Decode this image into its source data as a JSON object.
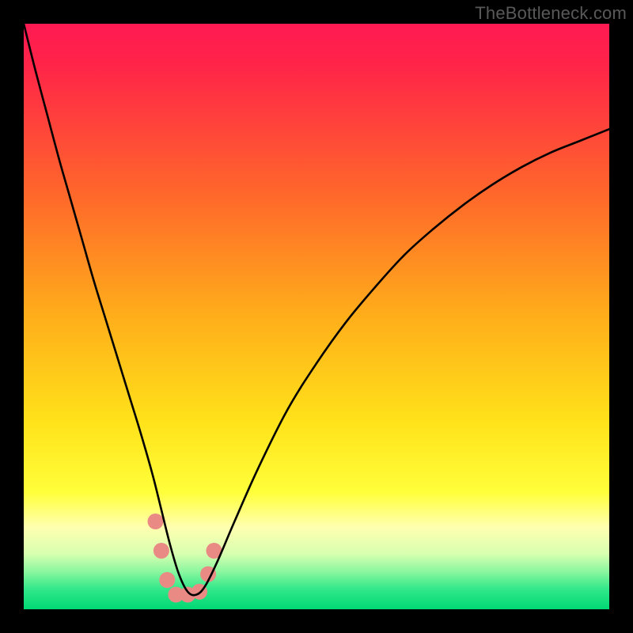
{
  "watermark": "TheBottleneck.com",
  "chart_data": {
    "type": "line",
    "title": "",
    "xlabel": "",
    "ylabel": "",
    "xlim": [
      0,
      100
    ],
    "ylim": [
      0,
      100
    ],
    "gradient_stops": [
      {
        "offset": 0.0,
        "color": "#ff1a52"
      },
      {
        "offset": 0.07,
        "color": "#ff2448"
      },
      {
        "offset": 0.3,
        "color": "#ff6a2a"
      },
      {
        "offset": 0.5,
        "color": "#ffae1a"
      },
      {
        "offset": 0.68,
        "color": "#ffe21a"
      },
      {
        "offset": 0.8,
        "color": "#ffff3a"
      },
      {
        "offset": 0.86,
        "color": "#ffffb0"
      },
      {
        "offset": 0.905,
        "color": "#d8ffb0"
      },
      {
        "offset": 0.935,
        "color": "#8cf7a0"
      },
      {
        "offset": 0.965,
        "color": "#33e88a"
      },
      {
        "offset": 1.0,
        "color": "#00d873"
      }
    ],
    "series": [
      {
        "name": "bottleneck-curve",
        "x": [
          0,
          2,
          4,
          6,
          8,
          10,
          12,
          14,
          16,
          18,
          20,
          22,
          23.5,
          25,
          26.5,
          28,
          29.5,
          31,
          33,
          36,
          40,
          45,
          50,
          55,
          60,
          65,
          70,
          75,
          80,
          85,
          90,
          95,
          100
        ],
        "y": [
          100,
          92,
          84.5,
          77,
          70,
          63,
          56,
          49.5,
          43,
          36.5,
          30,
          23,
          17,
          11,
          6,
          3,
          2.5,
          4,
          8,
          15,
          24,
          34,
          42,
          49,
          55,
          60.5,
          65,
          69,
          72.5,
          75.5,
          78,
          80,
          82
        ]
      }
    ],
    "dense_markers": {
      "color": "#e98a84",
      "radius_px": 10,
      "points": [
        {
          "x": 22.5,
          "y": 15
        },
        {
          "x": 23.5,
          "y": 10
        },
        {
          "x": 24.5,
          "y": 5
        },
        {
          "x": 26.0,
          "y": 2.5
        },
        {
          "x": 28.0,
          "y": 2.5
        },
        {
          "x": 30.0,
          "y": 3
        },
        {
          "x": 31.5,
          "y": 6
        },
        {
          "x": 32.5,
          "y": 10
        }
      ]
    }
  }
}
